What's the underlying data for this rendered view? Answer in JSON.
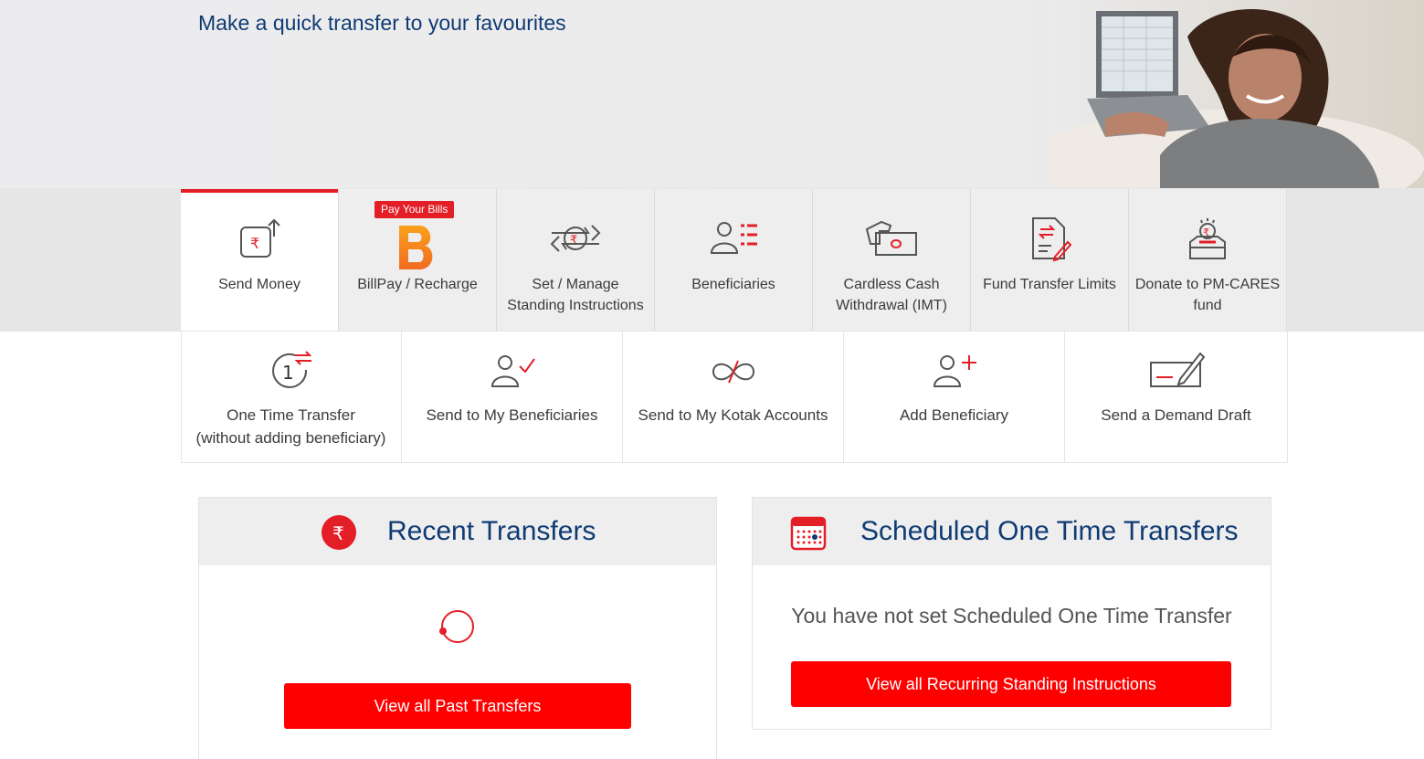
{
  "hero": {
    "title": "Make a quick transfer to your favourites"
  },
  "tabs": [
    {
      "label": "Send Money",
      "icon": "send-money-icon",
      "active": true
    },
    {
      "label": "BillPay / Recharge",
      "icon": "billpay-b-logo-icon",
      "badge": "Pay Your Bills"
    },
    {
      "label": "Set / Manage Standing Instructions",
      "icon": "standing-instructions-icon"
    },
    {
      "label": "Beneficiaries",
      "icon": "beneficiaries-icon"
    },
    {
      "label": "Cardless Cash Withdrawal (IMT)",
      "icon": "cardless-cash-icon"
    },
    {
      "label": "Fund Transfer Limits",
      "icon": "fund-transfer-limits-icon"
    },
    {
      "label": "Donate to PM-CARES fund",
      "icon": "donate-icon"
    }
  ],
  "actions": [
    {
      "label_line1": "One Time Transfer",
      "label_line2": "(without adding beneficiary)",
      "icon": "one-time-transfer-icon"
    },
    {
      "label_line1": "Send to My Beneficiaries",
      "icon": "send-beneficiaries-icon"
    },
    {
      "label_line1": "Send to My Kotak Accounts",
      "icon": "kotak-accounts-icon"
    },
    {
      "label_line1": "Add Beneficiary",
      "icon": "add-beneficiary-icon"
    },
    {
      "label_line1": "Send a Demand Draft",
      "icon": "demand-draft-icon"
    }
  ],
  "recent": {
    "title": "Recent Transfers",
    "button": "View all Past Transfers"
  },
  "scheduled": {
    "title": "Scheduled One Time Transfers",
    "empty_message": "You have not set Scheduled One Time Transfer",
    "button": "View all Recurring Standing Instructions"
  },
  "colors": {
    "accent": "#e41e26",
    "button": "#ff0000",
    "heading": "#0f3b73",
    "icon_gray": "#555555"
  }
}
